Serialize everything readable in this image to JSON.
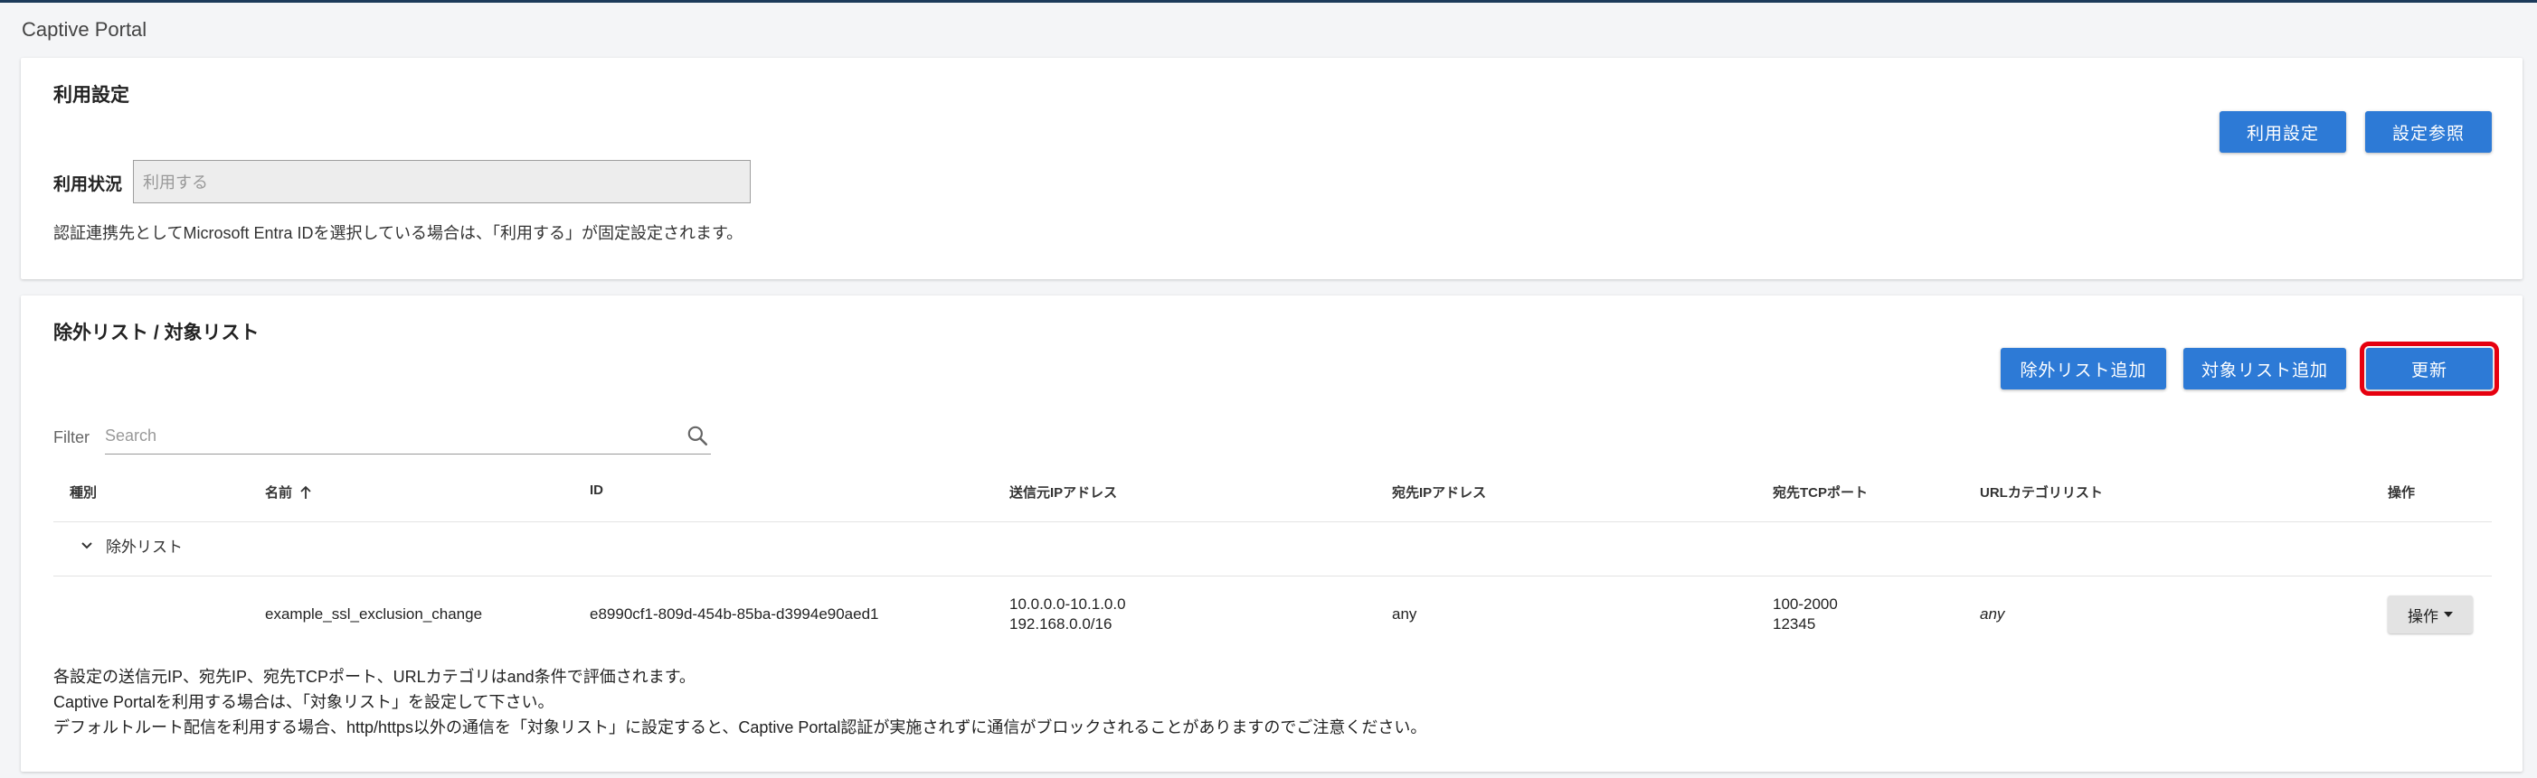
{
  "page": {
    "title": "Captive Portal"
  },
  "usage": {
    "title": "利用設定",
    "buttons": {
      "settings": "利用設定",
      "reference": "設定参照"
    },
    "status_label": "利用状況",
    "status_placeholder": "利用する",
    "note": "認証連携先としてMicrosoft Entra IDを選択している場合は、「利用する」が固定設定されます。"
  },
  "lists": {
    "title": "除外リスト / 対象リスト",
    "buttons": {
      "add_exclusion": "除外リスト追加",
      "add_target": "対象リスト追加",
      "refresh": "更新"
    },
    "filter_label": "Filter",
    "search_placeholder": "Search",
    "columns": {
      "type": "種別",
      "name": "名前",
      "id": "ID",
      "src_ip": "送信元IPアドレス",
      "dst_ip": "宛先IPアドレス",
      "dst_port": "宛先TCPポート",
      "url_category": "URLカテゴリリスト",
      "actions": "操作"
    },
    "group": {
      "label": "除外リスト"
    },
    "rows": [
      {
        "name": "example_ssl_exclusion_change",
        "id": "e8990cf1-809d-454b-85ba-d3994e90aed1",
        "src_ip": [
          "10.0.0.0-10.1.0.0",
          "192.168.0.0/16"
        ],
        "dst_ip": "any",
        "dst_port": [
          "100-2000",
          "12345"
        ],
        "url_category": "any",
        "action_label": "操作"
      }
    ],
    "footnotes": [
      "各設定の送信元IP、宛先IP、宛先TCPポート、URLカテゴリはand条件で評価されます。",
      "Captive Portalを利用する場合は、「対象リスト」を設定して下さい。",
      "デフォルトルート配信を利用する場合、http/https以外の通信を「対象リスト」に設定すると、Captive Portal認証が実施されずに通信がブロックされることがありますのでご注意ください。"
    ]
  },
  "colors": {
    "primary": "#2d7ad6",
    "highlight": "#e6000f",
    "topbar": "#1c3a5a"
  }
}
